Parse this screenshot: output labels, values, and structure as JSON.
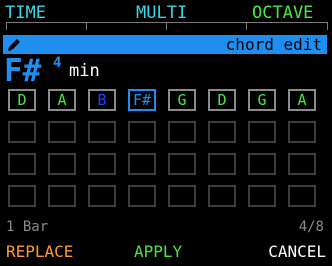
{
  "colors": {
    "cyan": "#35d8e6",
    "green": "#45e845",
    "blue": "#1e8ef0",
    "dark_blue": "#2040ff",
    "orange": "#ff9a2a",
    "grey": "#8a8a8a",
    "white": "#ffffff"
  },
  "topbar": {
    "time": "TIME",
    "multi": "MULTI",
    "octave": "OCTAVE"
  },
  "title_strip": {
    "icon": "pencil-icon",
    "text": "chord edit"
  },
  "chord": {
    "root": "F#",
    "octave": "4",
    "quality": "min"
  },
  "steps": [
    {
      "note": "D",
      "color": "#45e845",
      "selected": false
    },
    {
      "note": "A",
      "color": "#45e845",
      "selected": false
    },
    {
      "note": "B",
      "color": "#2040ff",
      "selected": false
    },
    {
      "note": "F#",
      "color": "#1e8ef0",
      "selected": true
    },
    {
      "note": "G",
      "color": "#45e845",
      "selected": false
    },
    {
      "note": "D",
      "color": "#45e845",
      "selected": false
    },
    {
      "note": "G",
      "color": "#45e845",
      "selected": false
    },
    {
      "note": "A",
      "color": "#45e845",
      "selected": false
    }
  ],
  "empty_rows": 3,
  "info": {
    "length": "1 Bar",
    "page": "4/8"
  },
  "actions": {
    "replace": "REPLACE",
    "apply": "APPLY",
    "cancel": "CANCEL"
  }
}
